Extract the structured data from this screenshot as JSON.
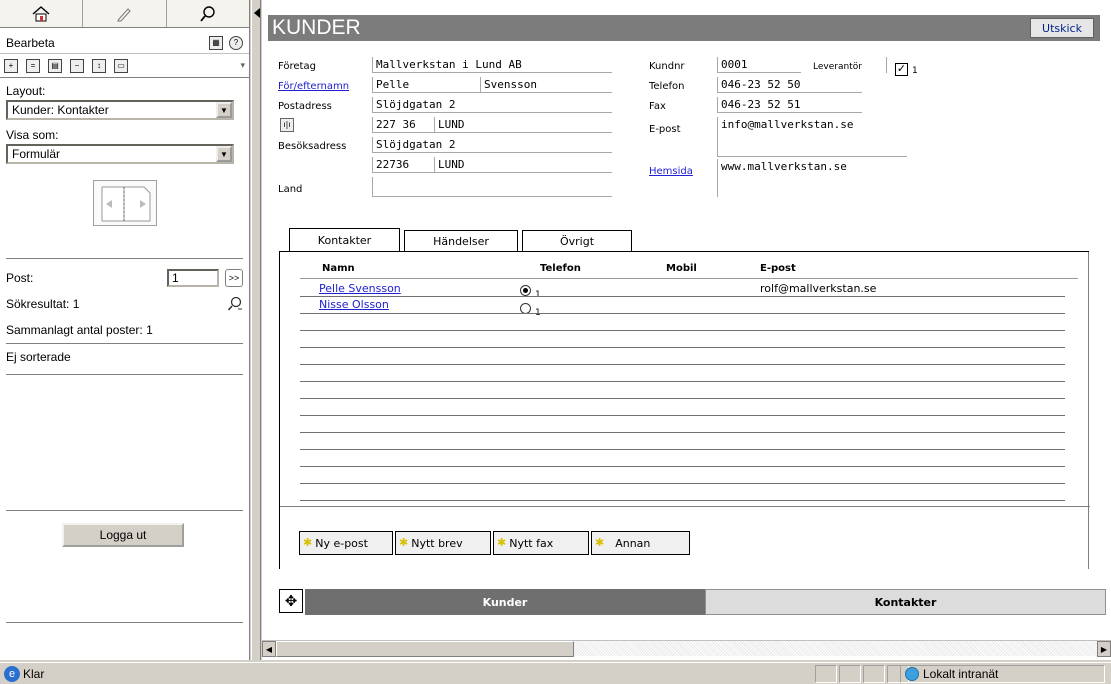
{
  "sidebar": {
    "bearbeta_label": "Bearbeta",
    "layout_label": "Layout:",
    "layout_value": "Kunder: Kontakter",
    "visa_som_label": "Visa som:",
    "visa_som_value": "Formulär",
    "post_label": "Post:",
    "post_value": "1",
    "sokresultat": "Sökresultat: 1",
    "sammanlagt": "Sammanlagt antal poster: 1",
    "sortering": "Ej sorterade",
    "logout_label": "Logga ut"
  },
  "main": {
    "title": "KUNDER",
    "utskick_label": "Utskick",
    "fields": {
      "foretag_label": "Företag",
      "foretag_value": "Mallverkstan i Lund AB",
      "namn_label": "För/efternamn",
      "fornamn_value": "Pelle",
      "efternamn_value": "Svensson",
      "postadress_label": "Postadress",
      "postadress_value": "Slöjdgatan 2",
      "postnr_value": "227 36",
      "ort_value": "LUND",
      "besoksadress_label": "Besöksadress",
      "besoksadress_value": "Slöjdgatan 2",
      "besok_postnr_value": "22736",
      "besok_ort_value": "LUND",
      "land_label": "Land",
      "land_value": "",
      "kundnr_label": "Kundnr",
      "kundnr_value": "0001",
      "leverantor_label": "Leverantör",
      "leverantor_value": "1",
      "telefon_label": "Telefon",
      "telefon_value": "046-23 52 50",
      "fax_label": "Fax",
      "fax_value": "046-23 52 51",
      "epost_label": "E-post",
      "epost_value": "info@mallverkstan.se",
      "hemsida_label": "Hemsida",
      "hemsida_value": "www.mallverkstan.se"
    },
    "tabs": [
      {
        "label": "Kontakter"
      },
      {
        "label": "Händelser"
      },
      {
        "label": "Övrigt"
      }
    ],
    "contacts": {
      "columns": [
        "Namn",
        "Telefon",
        "Mobil",
        "E-post"
      ],
      "rows": [
        {
          "namn": "Pelle Svensson",
          "telefon": "1",
          "mobil": "",
          "epost": "rolf@mallverkstan.se",
          "selected": true
        },
        {
          "namn": "Nisse Olsson",
          "telefon": "1",
          "mobil": "",
          "epost": "",
          "selected": false
        }
      ]
    },
    "actions": {
      "ny_epost": "Ny e-post",
      "nytt_brev": "Nytt brev",
      "nytt_fax": "Nytt fax",
      "annan": "Annan"
    },
    "bottom_nav": {
      "kunder": "Kunder",
      "kontakter": "Kontakter"
    }
  },
  "statusbar": {
    "status": "Klar",
    "zone": "Lokalt intranät"
  }
}
